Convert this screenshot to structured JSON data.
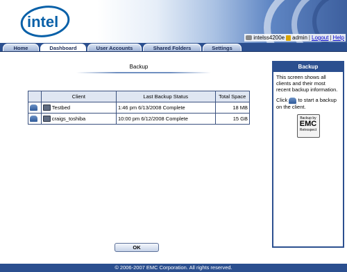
{
  "header": {
    "logo_text": "intel",
    "device_name": "intelss4200e",
    "user_name": "admin",
    "logout_label": "Logout",
    "help_label": "Help"
  },
  "tabs": [
    {
      "label": "Home"
    },
    {
      "label": "Dashboard"
    },
    {
      "label": "User Accounts"
    },
    {
      "label": "Shared Folders"
    },
    {
      "label": "Settings"
    }
  ],
  "main": {
    "section_title": "Backup",
    "columns": [
      "Client",
      "Last Backup Status",
      "Total Space"
    ],
    "rows": [
      {
        "client": "Testbed",
        "status": "1:46 pm 6/13/2008 Complete",
        "space": "18 MB"
      },
      {
        "client": "craigs_toshiba",
        "status": "10:00 pm 6/12/2008 Complete",
        "space": "15 GB"
      }
    ],
    "ok_label": "OK"
  },
  "panel": {
    "title": "Backup",
    "description": "This screen shows all clients and their most recent backup information.",
    "click_text_before": "Click",
    "click_text_after": "to start a backup on the client.",
    "emc_top": "Backup by",
    "emc_big": "EMC",
    "emc_bottom": "Retrospect"
  },
  "footer": {
    "copyright": "© 2006-2007 EMC Corporation. All rights reserved."
  },
  "colors": {
    "brand_blue": "#2b4f8f",
    "intel_blue": "#0860a8",
    "link_blue": "#0000cc"
  }
}
